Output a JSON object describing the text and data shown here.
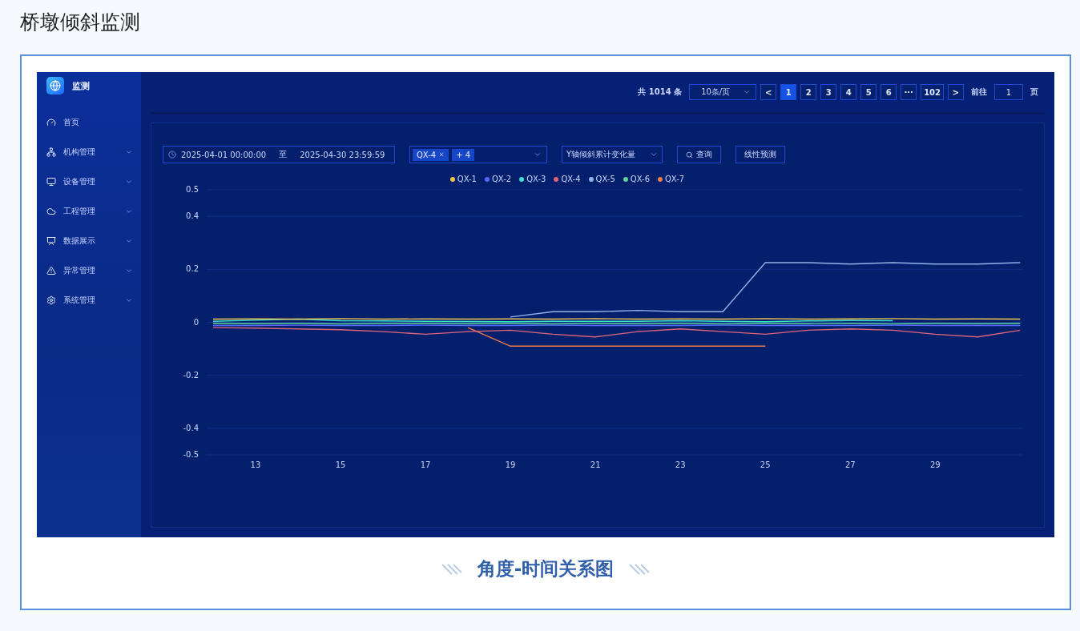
{
  "page_title": "桥墩倾斜监测",
  "app": {
    "logo_text": "监测",
    "sidebar": {
      "items": [
        {
          "label": "首页",
          "kind": "link"
        },
        {
          "label": "机构管理",
          "kind": "group"
        },
        {
          "label": "设备管理",
          "kind": "group"
        },
        {
          "label": "工程管理",
          "kind": "group"
        },
        {
          "label": "数据展示",
          "kind": "group"
        },
        {
          "label": "异常管理",
          "kind": "group"
        },
        {
          "label": "系统管理",
          "kind": "group"
        }
      ]
    },
    "pagination": {
      "total": "共 1014 条",
      "page_size": "10条/页",
      "prev": "<",
      "next": ">",
      "pages": [
        {
          "label": "1",
          "selected": true
        },
        {
          "label": "2",
          "selected": false
        },
        {
          "label": "3",
          "selected": false
        },
        {
          "label": "4",
          "selected": false
        },
        {
          "label": "5",
          "selected": false
        },
        {
          "label": "6",
          "selected": false
        },
        {
          "label": "···",
          "selected": false
        },
        {
          "label": "102",
          "selected": false
        }
      ],
      "goto_label": "前往",
      "goto_value": "1",
      "goto_suffix": "页"
    },
    "filters": {
      "start": "2025-04-01 00:00:00",
      "separator": "至",
      "end": "2025-04-30 23:59:59",
      "tags": [
        {
          "label": "QX-4",
          "removable": true
        },
        {
          "label": "+ 4",
          "removable": false
        }
      ],
      "metric": "Y轴倾斜累计变化量",
      "query_button": "查询",
      "predict_button": "线性预测"
    },
    "chart_data": {
      "type": "line",
      "grid": true,
      "x": [
        12,
        13,
        14,
        15,
        16,
        17,
        18,
        19,
        20,
        21,
        22,
        23,
        24,
        25,
        26,
        27,
        28,
        29,
        30,
        31
      ],
      "xlim": [
        11.85,
        31.05
      ],
      "ylim": [
        -0.5,
        0.5
      ],
      "xticks": [
        13,
        15,
        17,
        19,
        21,
        23,
        25,
        27,
        29
      ],
      "yticks": [
        -0.5,
        -0.4,
        -0.2,
        0,
        0.2,
        0.4,
        0.5
      ],
      "series": [
        {
          "name": "QX-1",
          "color": "#f2c14e",
          "values": [
            0.012,
            0.013,
            0.012,
            0.014,
            0.012,
            0.013,
            0.012,
            0.013,
            0.012,
            0.014,
            0.012,
            0.013,
            0.012,
            0.014,
            0.012,
            0.013,
            0.014,
            0.012,
            0.013,
            0.012
          ]
        },
        {
          "name": "QX-2",
          "color": "#5468ff",
          "values": [
            -0.012,
            -0.012,
            -0.011,
            -0.012,
            -0.012,
            -0.011,
            -0.012,
            -0.012,
            -0.011,
            -0.012,
            -0.012,
            -0.012,
            -0.011,
            -0.012,
            -0.012,
            -0.012,
            -0.011,
            -0.012,
            -0.012,
            -0.012
          ]
        },
        {
          "name": "QX-3",
          "color": "#3ee0d0",
          "values": [
            0.004,
            0.008,
            0.012,
            0.006,
            0.005,
            0.004,
            0.003,
            0.002,
            0.004,
            0.004,
            0.004,
            0.006,
            0.004,
            0.002,
            0.005,
            0.007,
            0.006,
            null,
            null,
            null
          ]
        },
        {
          "name": "QX-4",
          "color": "#e0647a",
          "values": [
            -0.02,
            -0.022,
            -0.025,
            -0.028,
            -0.035,
            -0.045,
            -0.035,
            -0.03,
            -0.045,
            -0.055,
            -0.035,
            -0.025,
            -0.035,
            -0.045,
            -0.03,
            -0.025,
            -0.03,
            -0.045,
            -0.055,
            -0.03
          ]
        },
        {
          "name": "QX-5",
          "color": "#8fb4e8",
          "values": [
            null,
            null,
            null,
            null,
            null,
            null,
            null,
            0.02,
            0.04,
            0.04,
            0.045,
            0.04,
            0.04,
            0.225,
            0.225,
            0.22,
            0.225,
            0.22,
            0.22,
            0.225
          ]
        },
        {
          "name": "QX-6",
          "color": "#5fd39a",
          "values": [
            -0.004,
            -0.005,
            -0.004,
            -0.006,
            -0.004,
            -0.004,
            -0.005,
            -0.004,
            -0.006,
            -0.004,
            -0.005,
            -0.004,
            -0.006,
            -0.004,
            -0.005,
            -0.004,
            -0.006,
            -0.004,
            -0.005,
            -0.004
          ]
        },
        {
          "name": "QX-7",
          "color": "#f07a4a",
          "values": [
            null,
            null,
            null,
            null,
            null,
            null,
            -0.02,
            -0.09,
            -0.09,
            -0.09,
            -0.09,
            -0.09,
            -0.09,
            -0.09,
            null,
            null,
            null,
            null,
            null,
            null
          ]
        }
      ]
    }
  },
  "caption": "角度-时间关系图"
}
